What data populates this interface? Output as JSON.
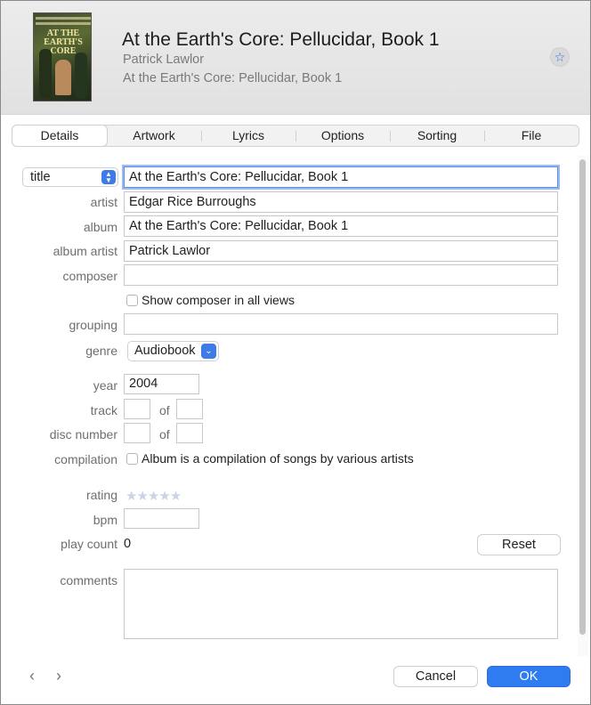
{
  "header": {
    "title": "At the Earth's Core: Pellucidar, Book 1",
    "artist": "Patrick Lawlor",
    "album": "At the Earth's Core: Pellucidar, Book 1",
    "cover_text_top": "EDGAR RICE BURROUGHS",
    "cover_text_title": "AT THE EARTH'S CORE",
    "star_icon": "☆"
  },
  "tabs": [
    {
      "label": "Details",
      "active": true
    },
    {
      "label": "Artwork",
      "active": false
    },
    {
      "label": "Lyrics",
      "active": false
    },
    {
      "label": "Options",
      "active": false
    },
    {
      "label": "Sorting",
      "active": false
    },
    {
      "label": "File",
      "active": false
    }
  ],
  "form": {
    "title_select": "title",
    "title_value": "At the Earth's Core: Pellucidar, Book 1",
    "artist_label": "artist",
    "artist_value": "Edgar Rice Burroughs",
    "album_label": "album",
    "album_value": "At the Earth's Core: Pellucidar, Book 1",
    "album_artist_label": "album artist",
    "album_artist_value": "Patrick Lawlor",
    "composer_label": "composer",
    "composer_value": "",
    "show_composer_label": "Show composer in all views",
    "grouping_label": "grouping",
    "grouping_value": "",
    "genre_label": "genre",
    "genre_value": "Audiobook",
    "year_label": "year",
    "year_value": "2004",
    "track_label": "track",
    "disc_label": "disc number",
    "of_label": "of",
    "compilation_label": "compilation",
    "compilation_text": "Album is a compilation of songs by various artists",
    "rating_label": "rating",
    "rating_value": 0,
    "rating_stars": "★★★★★",
    "bpm_label": "bpm",
    "play_count_label": "play count",
    "play_count_value": "0",
    "reset_label": "Reset",
    "comments_label": "comments"
  },
  "footer": {
    "prev_icon": "‹",
    "next_icon": "›",
    "cancel_label": "Cancel",
    "ok_label": "OK"
  },
  "colors": {
    "accent": "#2f7bf0",
    "focus_ring": "#9bbcf3"
  }
}
